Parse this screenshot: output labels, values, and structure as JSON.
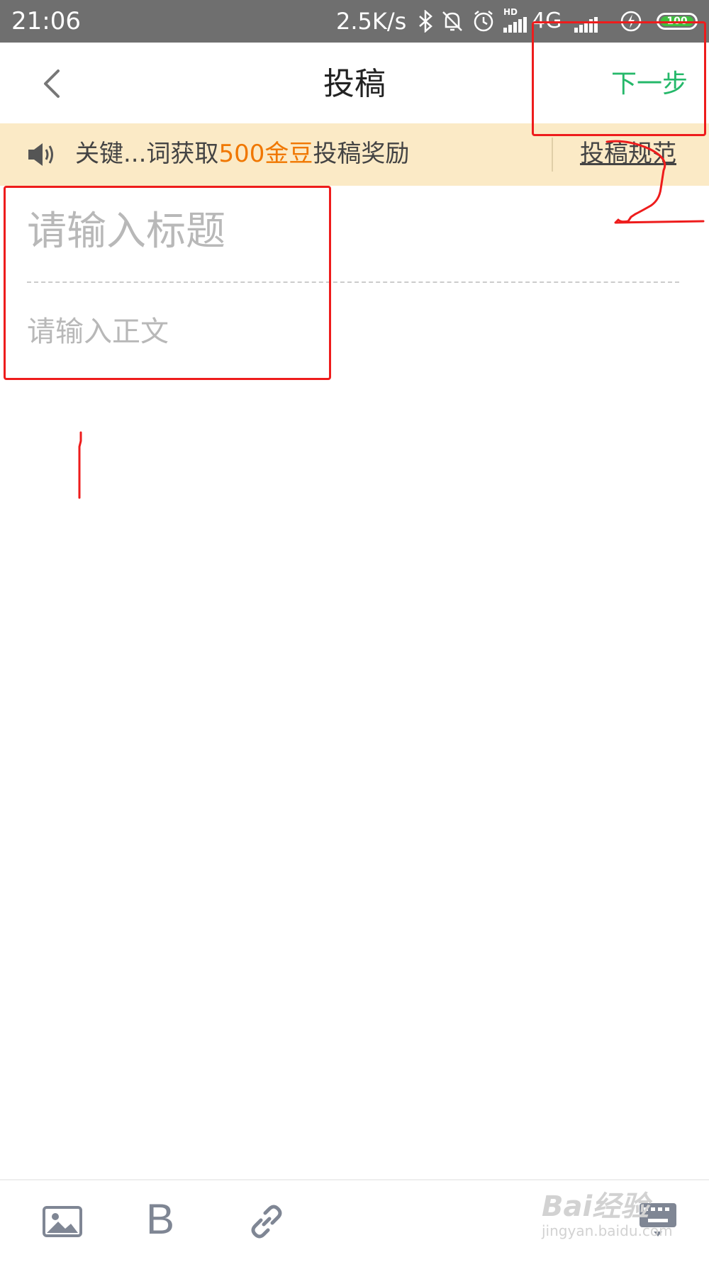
{
  "status_bar": {
    "time": "21:06",
    "net_speed": "2.5K/s",
    "network_type": "4G",
    "hd_label": "HD",
    "battery_level": "100",
    "icons": [
      "bluetooth-icon",
      "mute-bell-icon",
      "alarm-icon",
      "signal-icon",
      "signal-icon",
      "charging-icon",
      "battery-icon"
    ]
  },
  "header": {
    "title": "投稿",
    "next_label": "下一步",
    "back_icon": "chevron-left-icon"
  },
  "notice": {
    "text_before": "关键...词获取",
    "highlight": "500金豆",
    "text_after": "投稿奖励",
    "link_label": "投稿规范",
    "icon": "speaker-icon",
    "highlight_color": "#f07700",
    "background_color": "#fbeac6"
  },
  "editor": {
    "title_placeholder": "请输入标题",
    "body_placeholder": "请输入正文"
  },
  "toolbar": {
    "bold_label": "B",
    "icons": [
      "image-icon",
      "link-icon",
      "keyboard-hide-icon"
    ]
  },
  "annotations": {
    "step_number": "2",
    "color": "#ee1c1c"
  },
  "watermark": {
    "main": "Bai经验",
    "sub": "jingyan.baidu.com"
  },
  "colors": {
    "accent": "#25b86a",
    "status_bar": "#6f6f6f"
  }
}
